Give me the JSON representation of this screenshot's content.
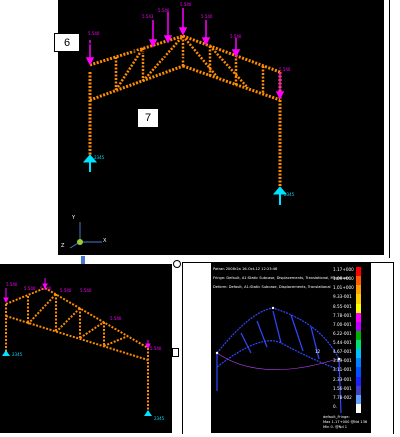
{
  "colors": {
    "truss": "#ff8c00",
    "load_arrow": "#ff00ff",
    "support": "#00e0ff",
    "background": "#000000",
    "dashed_box": "#000000",
    "connector": "#4a7ac9",
    "deformed": "#3048ff"
  },
  "top_view": {
    "load_labels": [
      "5.540",
      "5.543",
      "5.540",
      "5.540",
      "5.540",
      "5.540",
      "5.540"
    ],
    "support_labels": [
      "2345",
      "2345"
    ],
    "callout_6": "6",
    "callout_7": "7",
    "axis_x": "X",
    "axis_y": "Y",
    "axis_z": "Z"
  },
  "bottom_left_view": {
    "load_labels": [
      "5.540",
      "5.540",
      "5.540",
      "5.540",
      "5.540",
      "5.540",
      "5.540"
    ],
    "support_labels": [
      "2345",
      "2345"
    ]
  },
  "bottom_right_view": {
    "header_line1": "Patran 2008r2a 16-Oct-12 12:23:46",
    "header_line2": "Fringe: Default, A1:Static Subcase, Displacements, Translational, Magnitude",
    "header_line3": "Deform: Default, A1:Static Subcase, Displacements, Translational",
    "legend_values": [
      "1.17+000",
      "1.09+000",
      "1.01+000",
      "9.33-001",
      "8.55-001",
      "7.78-001",
      "7.00-001",
      "6.22-001",
      "5.44-001",
      "4.67-001",
      "3.89-001",
      "3.11-001",
      "2.33-001",
      "1.56-001",
      "7.78-002",
      "0."
    ],
    "legend_colors": [
      "#ff0000",
      "#ff5a00",
      "#ffa000",
      "#ffd000",
      "#ffff00",
      "#ff00ff",
      "#c000ff",
      "#00b000",
      "#00e070",
      "#00c0ff",
      "#0080ff",
      "#0050ff",
      "#2020ff",
      "#4040c0",
      "#60a0ff",
      "#ffffff"
    ],
    "footer_line1": "default_Fringe:",
    "footer_line2": "Max 1.17+000 @Nd 136",
    "footer_line3": "Min 0. @Nd 1",
    "mid_label": "12"
  }
}
